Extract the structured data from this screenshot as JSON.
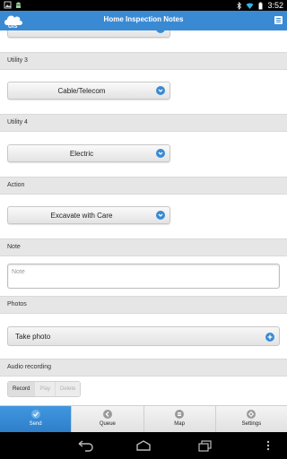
{
  "status_bar": {
    "time": "3:52"
  },
  "header": {
    "title": "Home Inspection Notes",
    "logo_text": "GIS"
  },
  "sections": [
    {
      "id": "utility3",
      "label": "Utility 3",
      "value": "Cable/Telecom"
    },
    {
      "id": "utility4",
      "label": "Utility 4",
      "value": "Electric"
    },
    {
      "id": "action",
      "label": "Action",
      "value": "Excavate with Care"
    }
  ],
  "note": {
    "label": "Note",
    "placeholder": "Note"
  },
  "photos": {
    "label": "Photos",
    "button": "Take photo"
  },
  "audio": {
    "label": "Audio recording",
    "buttons": [
      "Record",
      "Play",
      "Delete"
    ]
  },
  "tabs": [
    "Send",
    "Queue",
    "Map",
    "Settings"
  ],
  "accent": "#3a8ad3"
}
